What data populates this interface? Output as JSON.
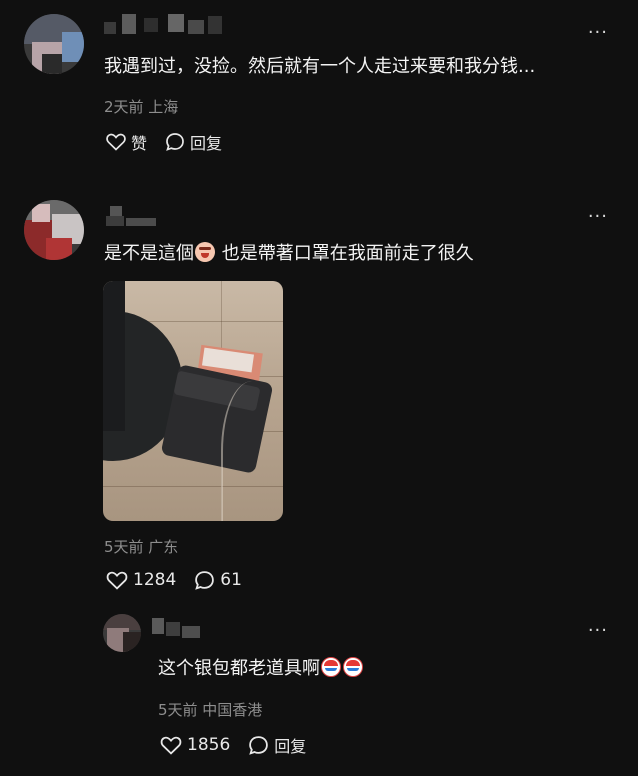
{
  "comments": [
    {
      "text": "我遇到过，没捡。然后就有一个人走过来要和我分钱...",
      "meta": "2天前 上海",
      "like_label": "赞",
      "reply_label": "回复",
      "more_label": "···"
    },
    {
      "text_a": "是不是這個",
      "emoji": "scream-face",
      "text_b": "也是帶著口罩在我面前走了很久",
      "meta": "5天前 广东",
      "like_count": "1284",
      "reply_count": "61",
      "more_label": "···"
    },
    {
      "text": "这个银包都老道具啊",
      "emoji": "crying-clown-face",
      "meta": "5天前 中国香港",
      "like_count": "1856",
      "reply_label": "回复",
      "more_label": "···"
    }
  ],
  "colors": {
    "background": "#101010",
    "text": "#f4f4f4",
    "meta": "#8e8e8e"
  }
}
